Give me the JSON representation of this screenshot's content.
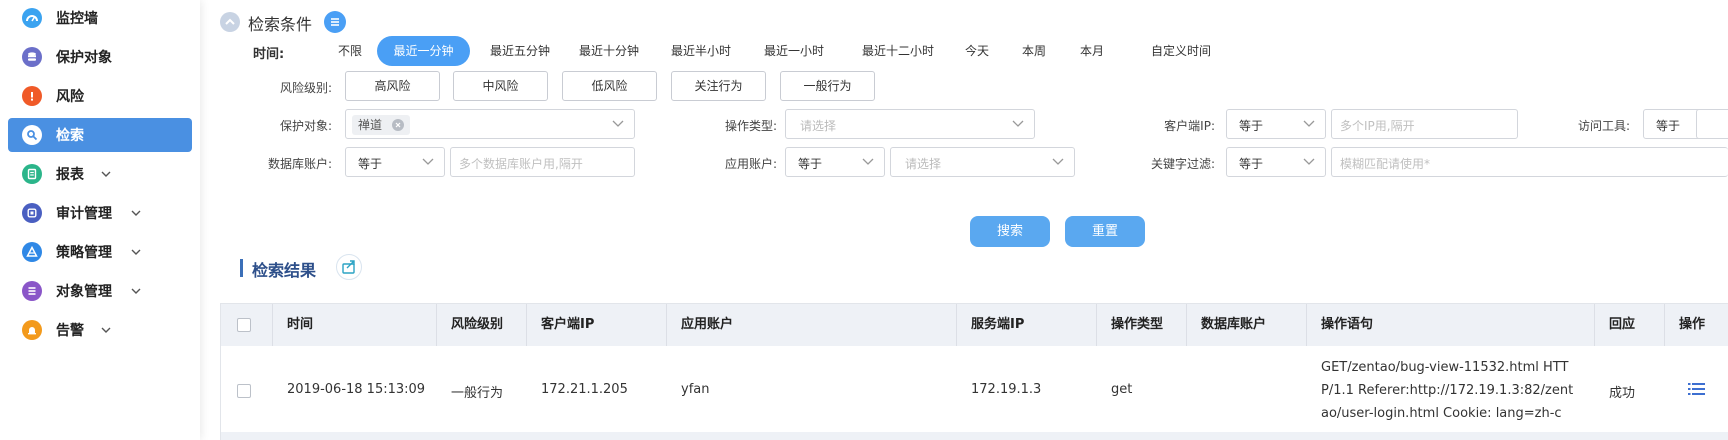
{
  "sidebar": {
    "items": [
      {
        "label": "监控墙",
        "icon": "dashboard-icon",
        "color": "#3ba3f0",
        "chevron": false,
        "active": false
      },
      {
        "label": "保护对象",
        "icon": "database-icon",
        "color": "#6b6fc9",
        "chevron": false,
        "active": false
      },
      {
        "label": "风险",
        "icon": "alert-icon",
        "color": "#f05a28",
        "chevron": false,
        "active": false
      },
      {
        "label": "检索",
        "icon": "search-icon",
        "color": "#ffffff",
        "chevron": false,
        "active": true
      },
      {
        "label": "报表",
        "icon": "report-icon",
        "color": "#2bb58a",
        "chevron": true,
        "active": false
      },
      {
        "label": "审计管理",
        "icon": "audit-icon",
        "color": "#4a5fc1",
        "chevron": true,
        "active": false
      },
      {
        "label": "策略管理",
        "icon": "policy-icon",
        "color": "#2f88e6",
        "chevron": true,
        "active": false
      },
      {
        "label": "对象管理",
        "icon": "list-icon",
        "color": "#8a56c8",
        "chevron": true,
        "active": false
      },
      {
        "label": "告警",
        "icon": "alarm-icon",
        "color": "#f39a1c",
        "chevron": true,
        "active": false
      }
    ]
  },
  "search": {
    "title": "检索条件",
    "time_label": "时间:",
    "time_options": [
      "不限",
      "最近一分钟",
      "最近五分钟",
      "最近十分钟",
      "最近半小时",
      "最近一小时",
      "最近十二小时",
      "今天",
      "本周",
      "本月",
      "自定义时间"
    ],
    "time_selected": 1,
    "risk_label": "风险级别:",
    "risk_options": [
      "高风险",
      "中风险",
      "低风险",
      "关注行为",
      "一般行为"
    ],
    "protect_label": "保护对象:",
    "protect_tag": "禅道",
    "op_type_label": "操作类型:",
    "op_type_placeholder": "请选择",
    "client_ip_label": "客户端IP:",
    "client_ip_op": "等于",
    "client_ip_placeholder": "多个IP用,隔开",
    "access_tool_label": "访问工具:",
    "access_tool_op": "等于",
    "db_account_label": "数据库账户:",
    "db_account_op": "等于",
    "db_account_placeholder": "多个数据库账户用,隔开",
    "app_account_label": "应用账户:",
    "app_account_op": "等于",
    "app_account_placeholder": "请选择",
    "keyword_label": "关键字过滤:",
    "keyword_op": "等于",
    "keyword_placeholder": "模糊匹配请使用*",
    "search_button": "搜索",
    "reset_button": "重置"
  },
  "results": {
    "title": "检索结果",
    "columns": [
      "时间",
      "风险级别",
      "客户端IP",
      "应用账户",
      "服务端IP",
      "操作类型",
      "数据库账户",
      "操作语句",
      "回应",
      "操作"
    ],
    "rows": [
      {
        "time": "2019-06-18 15:13:09",
        "risk": "一般行为",
        "client_ip": "172.21.1.205",
        "app_account": "yfan",
        "server_ip": "172.19.1.3",
        "op_type": "get",
        "db_account": "",
        "statement_lines": [
          "GET/zentao/bug-view-11532.html HTT",
          "P/1.1 Referer:http://172.19.1.3:82/zent",
          "ao/user-login.html Cookie: lang=zh-c"
        ],
        "response": "成功"
      }
    ]
  },
  "colors": {
    "accent": "#4a90e2",
    "primary_button": "#5aa8f0",
    "header_bg": "#eef1f6"
  }
}
